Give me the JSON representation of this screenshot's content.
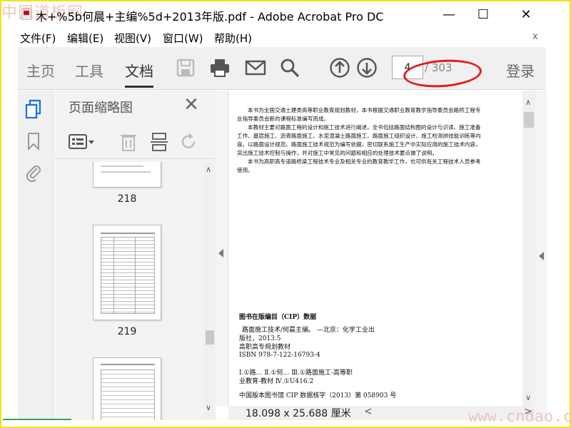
{
  "window": {
    "title": "木+%5b何晨+主编%5d+2013年版.pdf - Adobe Acrobat Pro DC",
    "minimize": "—",
    "maximize": "☐",
    "close": "✕"
  },
  "watermarks": {
    "top": "中国道板网",
    "bottom": "www.cndao.com"
  },
  "menu": {
    "items": [
      "文件(F)",
      "编辑(E)",
      "视图(V)",
      "窗口(W)",
      "帮助(H)"
    ],
    "close_x": "x"
  },
  "toolbar": {
    "tabs": [
      "主页",
      "工具",
      "文档"
    ],
    "active_tab": "文档",
    "page_current": "4",
    "page_total": "/ 303",
    "login": "登录",
    "icons": [
      "save-icon",
      "print-icon",
      "email-icon",
      "search-icon",
      "page-up-icon",
      "page-down-icon"
    ]
  },
  "panel": {
    "title": "页面缩略图",
    "close": "✕",
    "thumbnails": [
      {
        "label": "218"
      },
      {
        "label": "219"
      },
      {
        "label": ""
      }
    ]
  },
  "document": {
    "size_label": "18.098 x 25.688 厘米",
    "paragraphs": [
      "本书为全国交通土建类高等职业教育规划教材，本书根据交通职业教育教学指导委员会路桥工程专",
      "业指导委员会新的课程标准编写而成。",
      "本教材主要对路面工程的设计和施工技术进行阐述，全书包括路面结构图的设计与识读、施工准备",
      "工作、基层施工、沥青路面施工、水泥混凝土路面施工、路面施工组织设计、施工检测拼技能训练等内",
      "容。以路面设计规范、路面施工技术规范为编写依据，密切联系施工生产中实际应用的施工技术内容，",
      "突出施工技术控制与操作，并对施工中常见的问题和相应的处理技术要点做了说明。",
      "本书为高职高专道路桥梁工程技术专业及相关专业的教育教学工作，也可供有关工程技术人员参考",
      "使用。"
    ],
    "cip_heading": "图书在版编目（CIP）数据",
    "cip_lines": [
      "路面施工技术/何晨主编。 —北京：化学工业出",
      "版社，2013.5",
      "高职高专规划教材",
      "ISBN 978-7-122-16793-4",
      "",
      "Ⅰ.①路…   Ⅱ.①何…   Ⅲ.①路面施工-高等职",
      "业教育-教材   Ⅳ.①U416.2",
      "",
      "中国版本图书馆 CIP 数据核字（2013）第 058903 号"
    ]
  },
  "colors": {
    "annotation": "#e8191a",
    "frame": "#f2e21a",
    "toolbar_bg": "#f0f0f0"
  }
}
